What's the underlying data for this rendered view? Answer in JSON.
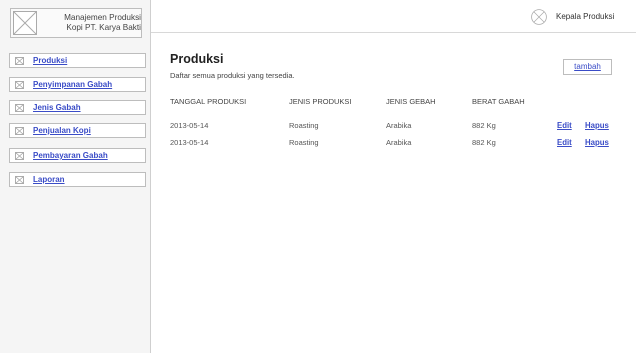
{
  "app": {
    "name": "Manajemen Produksi\nKopi PT. Karya Bakti"
  },
  "sidebar": {
    "items": [
      {
        "label": "Produksi"
      },
      {
        "label": "Penyimpanan Gabah"
      },
      {
        "label": "Jenis Gabah"
      },
      {
        "label": "Penjualan Kopi"
      },
      {
        "label": "Pembayaran Gabah"
      },
      {
        "label": "Laporan"
      }
    ]
  },
  "header": {
    "user": "Kepala Produksi"
  },
  "main": {
    "title": "Produksi",
    "subtitle": "Daftar semua produksi yang tersedia.",
    "add_button": "tambah",
    "table": {
      "columns": [
        "TANGGAL PRODUKSI",
        "JENIS PRODUKSI",
        "JENIS GEBAH",
        "BERAT GABAH"
      ],
      "rows": [
        {
          "tanggal": "2013-05-14",
          "jenis_produksi": "Roasting",
          "jenis_gabah": "Arabika",
          "berat": "882 Kg",
          "edit": "Edit",
          "hapus": "Hapus"
        },
        {
          "tanggal": "2013-05-14",
          "jenis_produksi": "Roasting",
          "jenis_gabah": "Arabika",
          "berat": "882 Kg",
          "edit": "Edit",
          "hapus": "Hapus"
        }
      ]
    }
  },
  "icons": {
    "brand": "image-placeholder-icon",
    "nav": "image-placeholder-icon",
    "avatar": "user-placeholder-icon"
  },
  "colors": {
    "link": "#3a4cc7",
    "sidebar_bg": "#f5f5f5",
    "border": "#bdbdbd"
  }
}
